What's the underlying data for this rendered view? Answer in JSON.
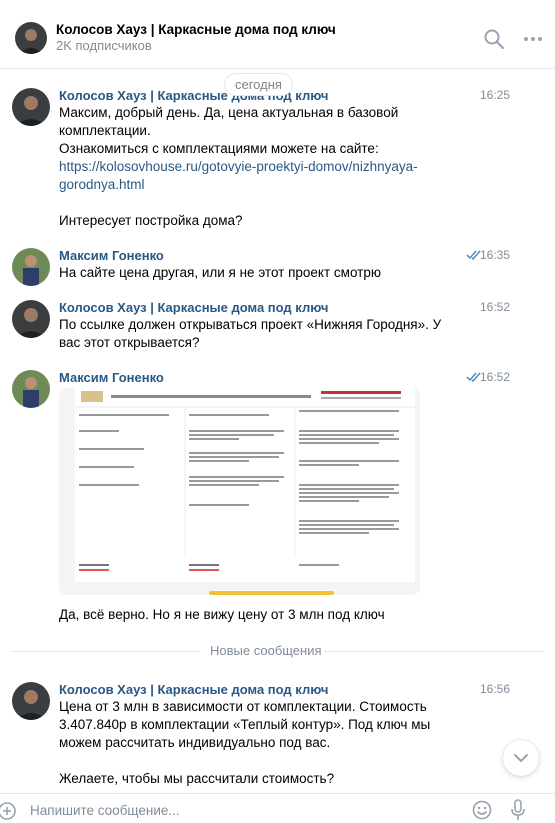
{
  "header": {
    "title": "Колосов Хауз | Каркасные дома под ключ",
    "subtitle": "2K подписчиков"
  },
  "date_separator": "сегодня",
  "messages": [
    {
      "author": "Колосов Хауз | Каркасные дома под ключ",
      "time": "16:25",
      "lines": [
        "Максим, добрый день. Да, цена актуальная в базовой комплектации.",
        "Ознакомиться с комплектациями можете на сайте:"
      ],
      "link": "https://kolosovhouse.ru/gotovyie-proektyi-domov/nizhnyaya-gorodnya.html",
      "question": "Интересует постройка дома?"
    },
    {
      "author": "Максим Гоненко",
      "time": "16:35",
      "text": "На сайте цена другая, или я не этот проект смотрю"
    },
    {
      "author": "Колосов Хауз | Каркасные дома под ключ",
      "time": "16:52",
      "text": "По ссылке должен открываться проект «Нижняя Городня». У вас этот открывается?"
    },
    {
      "author": "Максим Гоненко",
      "time": "16:52",
      "text": "Да, всё верно. Но я не вижу цену от 3 млн под ключ"
    },
    {
      "author": "Колосов Хауз | Каркасные дома под ключ",
      "time": "16:56",
      "text": "Цена от 3 млн в зависимости от комплектации. Стоимость 3.407.840р в комплектации «Теплый контур». Под ключ мы можем рассчитать индивидуально под вас.",
      "question": "Желаете, чтобы мы рассчитали стоимость?"
    }
  ],
  "new_messages_label": "Новые сообщения",
  "composer": {
    "placeholder": "Напишите сообщение..."
  },
  "icons": {
    "search": "search-icon",
    "more": "more-icon",
    "read": "double-check-icon",
    "scroll_down": "chevron-down-icon",
    "attach": "plus-circle-icon",
    "emoji": "smile-icon",
    "mic": "microphone-icon"
  },
  "colors": {
    "author": "#2a5885",
    "link": "#2a5885",
    "meta": "#818c99",
    "read_checks": "#5181b8"
  }
}
